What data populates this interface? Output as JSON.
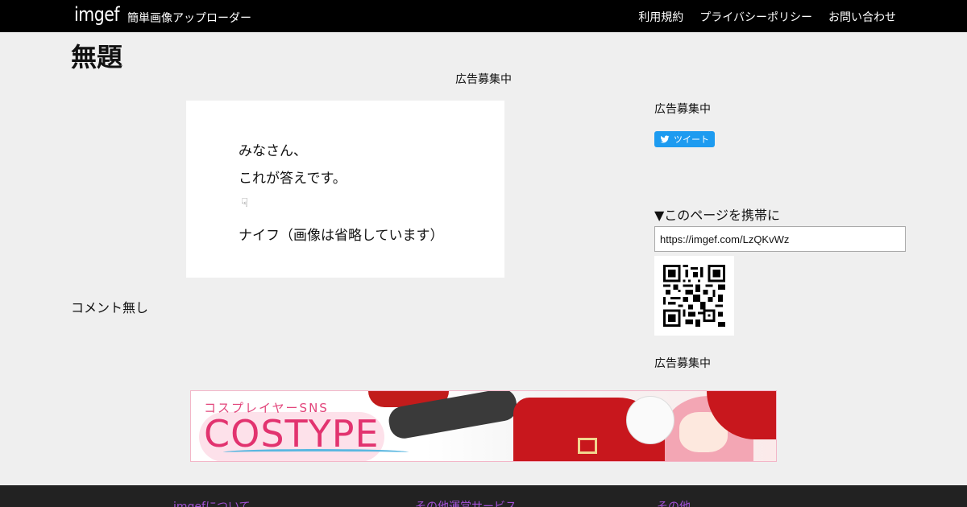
{
  "header": {
    "logo": "imgef",
    "tagline": "簡単画像アップローダー",
    "nav": [
      "利用規約",
      "プライバシーポリシー",
      "お問い合わせ"
    ]
  },
  "main": {
    "title": "無題",
    "ad_top": "広告募集中",
    "image_text": {
      "line1": "みなさん、",
      "line2": "これが答えです。",
      "icon": "pointing-down-hand-icon",
      "line3": "ナイフ（画像は省略しています）"
    },
    "comment": "コメント無し"
  },
  "sidebar": {
    "ad1": "広告募集中",
    "tweet_label": "ツイート",
    "mobile_label": "▼このページを携帯に",
    "url": "https://imgef.com/LzQKvWz",
    "qr_icon": "qr-code-icon",
    "ad2": "広告募集中"
  },
  "banner": {
    "sub": "コスプレイヤーSNS",
    "brand": "COSTYPE"
  },
  "footer": {
    "links": [
      "imgefについて",
      "その他運営サービス",
      "その他"
    ]
  },
  "colors": {
    "header_bg": "#000000",
    "tweet": "#1d9bf0",
    "footer_link": "#a352d6",
    "brand_pink": "#e2336f"
  }
}
